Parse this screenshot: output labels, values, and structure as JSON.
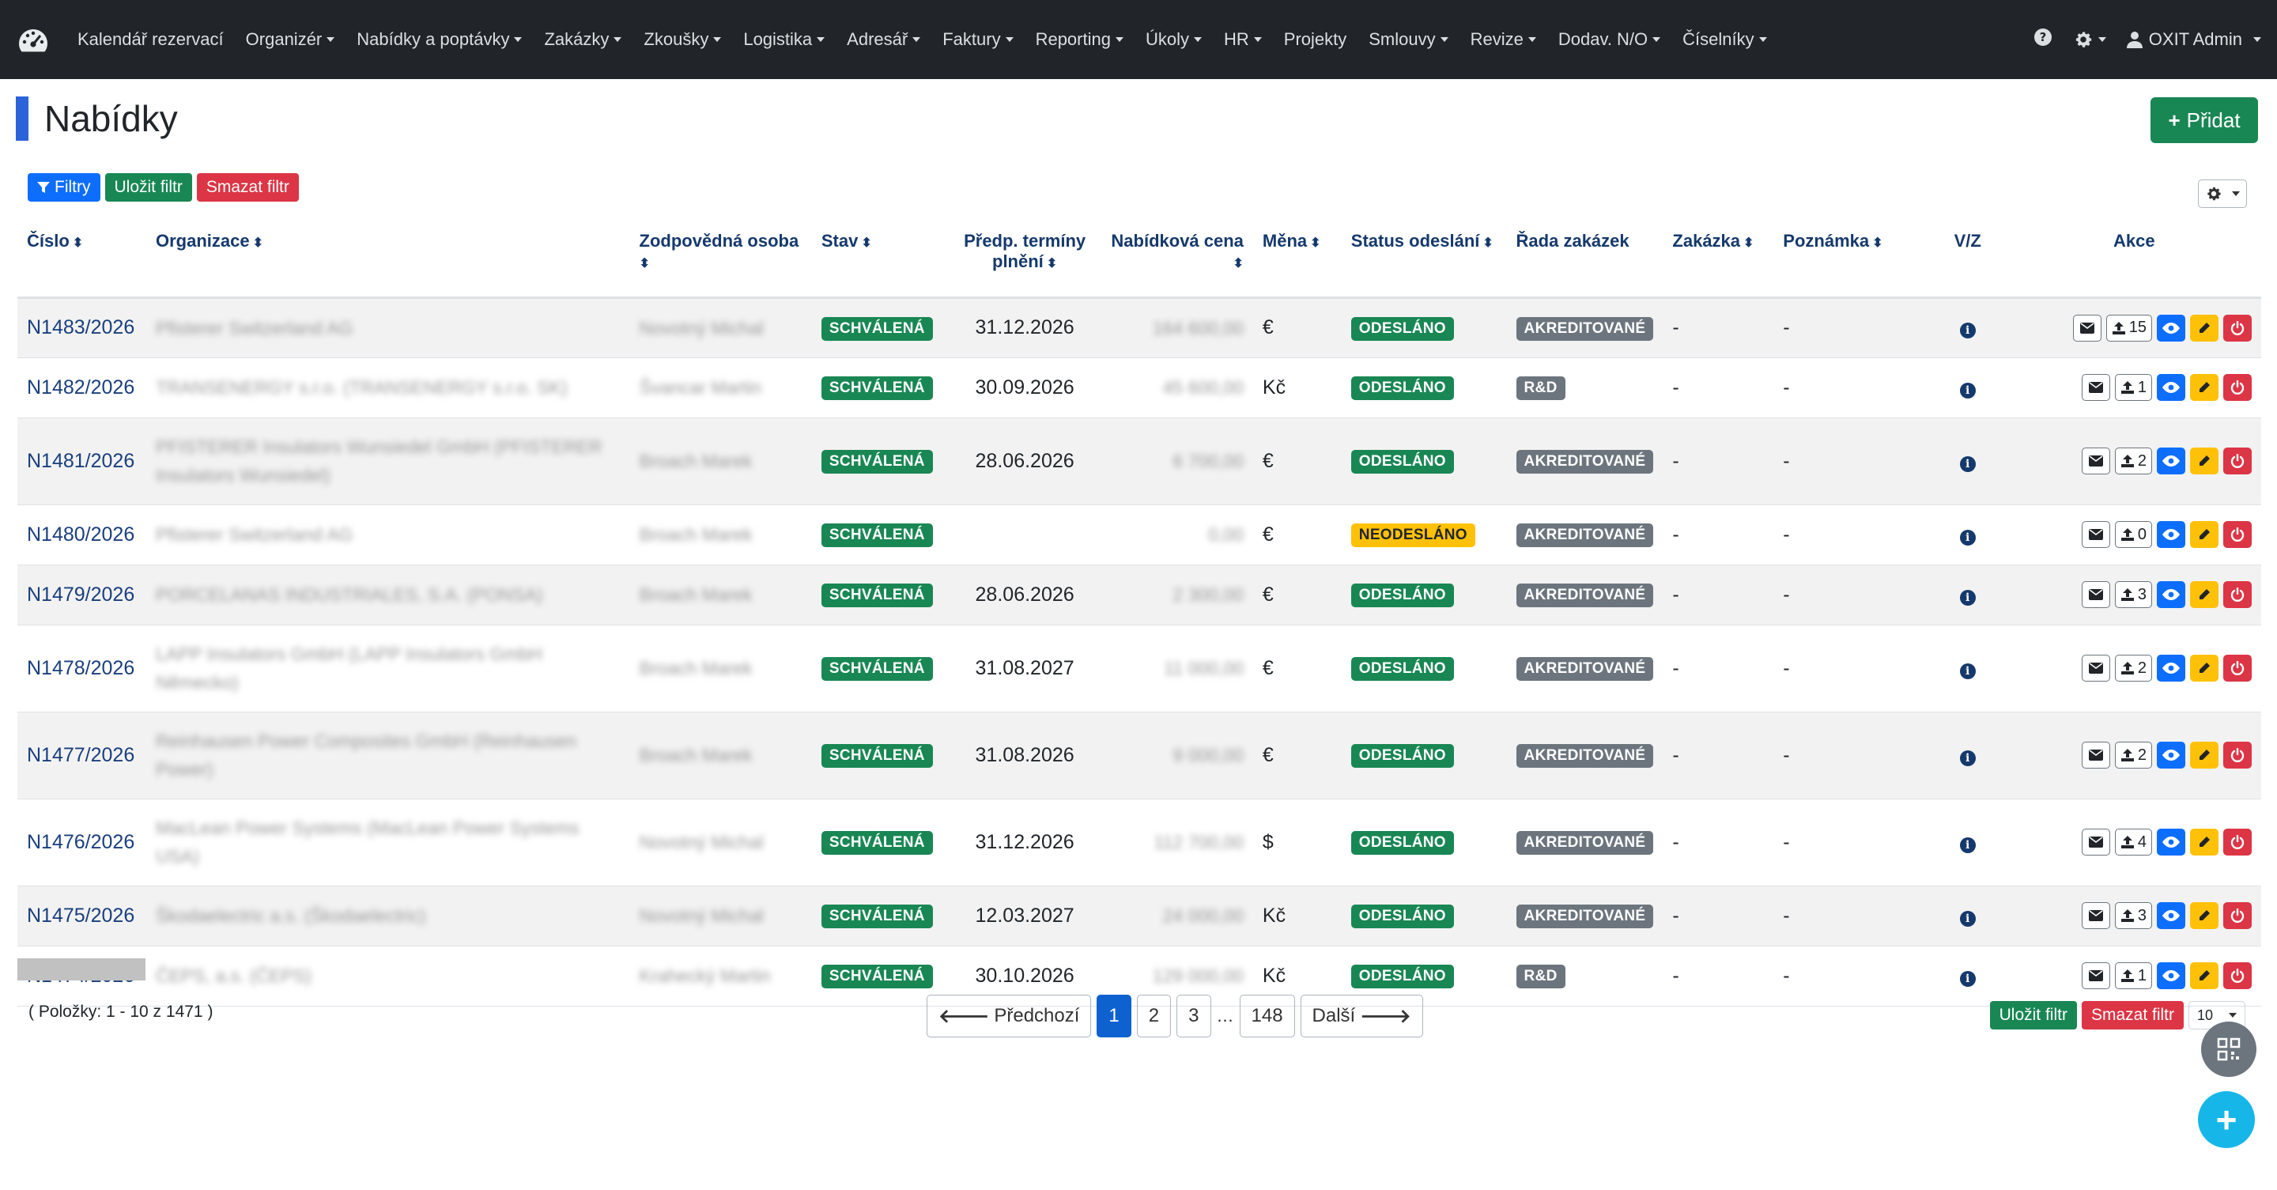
{
  "nav": {
    "items": [
      "Kalendář rezervací",
      "Organizér",
      "Nabídky a poptávky",
      "Zakázky",
      "Zkoušky",
      "Logistika",
      "Adresář",
      "Faktury",
      "Reporting",
      "Úkoly",
      "HR",
      "Projekty",
      "Smlouvy",
      "Revize",
      "Dodav. N/O",
      "Číselníky"
    ],
    "has_caret": [
      false,
      true,
      true,
      true,
      true,
      true,
      true,
      true,
      true,
      true,
      true,
      false,
      true,
      true,
      true,
      true
    ],
    "user": "OXIT Admin"
  },
  "page": {
    "title": "Nabídky",
    "add_label": "Přidat"
  },
  "filters": {
    "filter_label": "Filtry",
    "save_label": "Uložit filtr",
    "clear_label": "Smazat filtr"
  },
  "table": {
    "headers": {
      "cislo": "Číslo",
      "organizace": "Organizace",
      "osoba": "Zodpovědná osoba",
      "stav": "Stav",
      "terminy": "Předp. termíny plnění",
      "cena": "Nabídková cena",
      "mena": "Měna",
      "status": "Status odeslání",
      "rada": "Řada zakázek",
      "zakazka": "Zakázka",
      "poznamka": "Poznámka",
      "vz": "V/Z",
      "akce": "Akce"
    },
    "rows": [
      {
        "cislo": "N1483/2026",
        "org": "Pfisterer Switzerland AG",
        "osoba": "Novotný Michal",
        "stav": "SCHVÁLENÁ",
        "termin": "31.12.2026",
        "cena": "164 600,00",
        "mena": "€",
        "status": "ODESLÁNO",
        "rada": "AKREDITOVANÉ",
        "zakazka": "-",
        "poznamka": "-",
        "count": "15"
      },
      {
        "cislo": "N1482/2026",
        "org": "TRANSENERGY s.r.o. (TRANSENERGY s.r.o. SK)",
        "osoba": "Švancar Martin",
        "stav": "SCHVÁLENÁ",
        "termin": "30.09.2026",
        "cena": "45 600,00",
        "mena": "Kč",
        "status": "ODESLÁNO",
        "rada": "R&D",
        "zakazka": "-",
        "poznamka": "-",
        "count": "1"
      },
      {
        "cislo": "N1481/2026",
        "org": "PFISTERER Insulators Wunsiedel GmbH (PFISTERER Insulators Wunsiedel)",
        "osoba": "Broach Marek",
        "stav": "SCHVÁLENÁ",
        "termin": "28.06.2026",
        "cena": "6 700,00",
        "mena": "€",
        "status": "ODESLÁNO",
        "rada": "AKREDITOVANÉ",
        "zakazka": "-",
        "poznamka": "-",
        "count": "2"
      },
      {
        "cislo": "N1480/2026",
        "org": "Pfisterer Switzerland AG",
        "osoba": "Broach Marek",
        "stav": "SCHVÁLENÁ",
        "termin": "",
        "cena": "0,00",
        "mena": "€",
        "status": "NEODESLÁNO",
        "rada": "AKREDITOVANÉ",
        "zakazka": "-",
        "poznamka": "-",
        "count": "0"
      },
      {
        "cislo": "N1479/2026",
        "org": "PORCELANAS INDUSTRIALES, S.A. (PONSA)",
        "osoba": "Broach Marek",
        "stav": "SCHVÁLENÁ",
        "termin": "28.06.2026",
        "cena": "2 300,00",
        "mena": "€",
        "status": "ODESLÁNO",
        "rada": "AKREDITOVANÉ",
        "zakazka": "-",
        "poznamka": "-",
        "count": "3"
      },
      {
        "cislo": "N1478/2026",
        "org": "LAPP Insulators GmbH (LAPP Insulators GmbH Německo)",
        "osoba": "Broach Marek",
        "stav": "SCHVÁLENÁ",
        "termin": "31.08.2027",
        "cena": "11 000,00",
        "mena": "€",
        "status": "ODESLÁNO",
        "rada": "AKREDITOVANÉ",
        "zakazka": "-",
        "poznamka": "-",
        "count": "2"
      },
      {
        "cislo": "N1477/2026",
        "org": "Reinhausen Power Composites GmbH (Reinhausen Power)",
        "osoba": "Broach Marek",
        "stav": "SCHVÁLENÁ",
        "termin": "31.08.2026",
        "cena": "9 000,00",
        "mena": "€",
        "status": "ODESLÁNO",
        "rada": "AKREDITOVANÉ",
        "zakazka": "-",
        "poznamka": "-",
        "count": "2"
      },
      {
        "cislo": "N1476/2026",
        "org": "MacLean Power Systems (MacLean Power Systems USA)",
        "osoba": "Novotný Michal",
        "stav": "SCHVÁLENÁ",
        "termin": "31.12.2026",
        "cena": "112 700,00",
        "mena": "$",
        "status": "ODESLÁNO",
        "rada": "AKREDITOVANÉ",
        "zakazka": "-",
        "poznamka": "-",
        "count": "4"
      },
      {
        "cislo": "N1475/2026",
        "org": "Škodaelectric a.s. (Škodaelectric)",
        "osoba": "Novotný Michal",
        "stav": "SCHVÁLENÁ",
        "termin": "12.03.2027",
        "cena": "24 000,00",
        "mena": "Kč",
        "status": "ODESLÁNO",
        "rada": "AKREDITOVANÉ",
        "zakazka": "-",
        "poznamka": "-",
        "count": "3"
      },
      {
        "cislo": "N1474/2026",
        "org": "ČEPS, a.s. (ČEPS)",
        "osoba": "Krahecký Martin",
        "stav": "SCHVÁLENÁ",
        "termin": "30.10.2026",
        "cena": "129 000,00",
        "mena": "Kč",
        "status": "ODESLÁNO",
        "rada": "R&D",
        "zakazka": "-",
        "poznamka": "-",
        "count": "1"
      }
    ]
  },
  "footer": {
    "items_label": "( Položky: 1 - 10 z 1471 )",
    "prev_label": "Předchozí",
    "next_label": "Další",
    "pages": [
      "1",
      "2",
      "3",
      "148"
    ],
    "ellipsis": "…",
    "page_size": "10"
  }
}
